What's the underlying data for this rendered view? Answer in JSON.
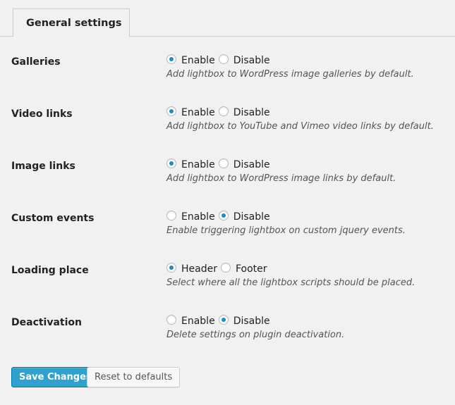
{
  "tabs": [
    {
      "label": "General settings"
    }
  ],
  "settings": [
    {
      "label": "Galleries",
      "options": [
        {
          "label": "Enable",
          "selected": true
        },
        {
          "label": "Disable",
          "selected": false
        }
      ],
      "description": "Add lightbox to WordPress image galleries by default."
    },
    {
      "label": "Video links",
      "options": [
        {
          "label": "Enable",
          "selected": true
        },
        {
          "label": "Disable",
          "selected": false
        }
      ],
      "description": "Add lightbox to YouTube and Vimeo video links by default."
    },
    {
      "label": "Image links",
      "options": [
        {
          "label": "Enable",
          "selected": true
        },
        {
          "label": "Disable",
          "selected": false
        }
      ],
      "description": "Add lightbox to WordPress image links by default."
    },
    {
      "label": "Custom events",
      "options": [
        {
          "label": "Enable",
          "selected": false
        },
        {
          "label": "Disable",
          "selected": true
        }
      ],
      "description": "Enable triggering lightbox on custom jquery events."
    },
    {
      "label": "Loading place",
      "options": [
        {
          "label": "Header",
          "selected": true
        },
        {
          "label": "Footer",
          "selected": false
        }
      ],
      "description": "Select where all the lightbox scripts should be placed."
    },
    {
      "label": "Deactivation",
      "options": [
        {
          "label": "Enable",
          "selected": false
        },
        {
          "label": "Disable",
          "selected": true
        }
      ],
      "description": "Delete settings on plugin deactivation."
    }
  ],
  "buttons": {
    "save": "Save Changes",
    "reset": "Reset to defaults"
  },
  "colors": {
    "accent": "#2ea2cc",
    "radio_dot": "#1e8cbe",
    "background": "#f1f1f1"
  }
}
